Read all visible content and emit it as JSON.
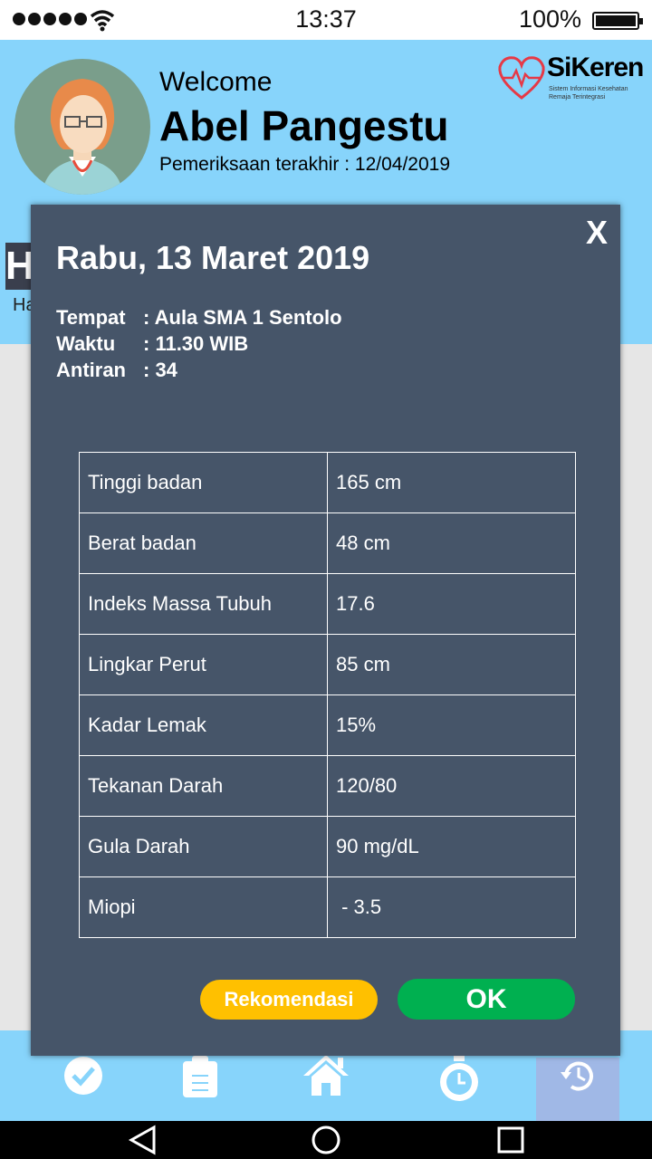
{
  "status": {
    "time": "13:37",
    "battery": "100%"
  },
  "header": {
    "welcome": "Welcome",
    "name": "Abel Pangestu",
    "last_check": "Pemeriksaan terakhir : 12/04/2019"
  },
  "logo": {
    "title": "SiKeren",
    "subtitle": "Sistem Informasi Kesehatan Remaja Terintegrasi"
  },
  "background": {
    "heading_initial": "H",
    "sub_initial": "Ha"
  },
  "modal": {
    "close": "X",
    "date": "Rabu, 13 Maret 2019",
    "info": [
      {
        "label": "Tempat",
        "value": ": Aula SMA 1 Sentolo"
      },
      {
        "label": "Waktu",
        "value": ": 11.30  WIB"
      },
      {
        "label": "Antiran",
        "value": ": 34"
      }
    ],
    "table": [
      {
        "label": "Tinggi badan",
        "value": "165 cm"
      },
      {
        "label": "Berat badan",
        "value": "48 cm"
      },
      {
        "label": "Indeks Massa Tubuh",
        "value": "17.6"
      },
      {
        "label": "Lingkar Perut",
        "value": "85 cm"
      },
      {
        "label": "Kadar Lemak",
        "value": "15%"
      },
      {
        "label": "Tekanan Darah",
        "value": "120/80"
      },
      {
        "label": "Gula Darah",
        "value": "90  mg/dL"
      },
      {
        "label": "Miopi",
        "value": " - 3.5"
      }
    ],
    "recommend_label": "Rekomendasi",
    "ok_label": "OK"
  },
  "nav": {
    "items": [
      "check-icon",
      "clipboard-icon",
      "home-icon",
      "stopwatch-icon",
      "history-icon"
    ],
    "active": "history-icon"
  },
  "colors": {
    "header": "#87d4fb",
    "modal": "#465569",
    "recommend": "#ffc000",
    "ok": "#00b050"
  }
}
